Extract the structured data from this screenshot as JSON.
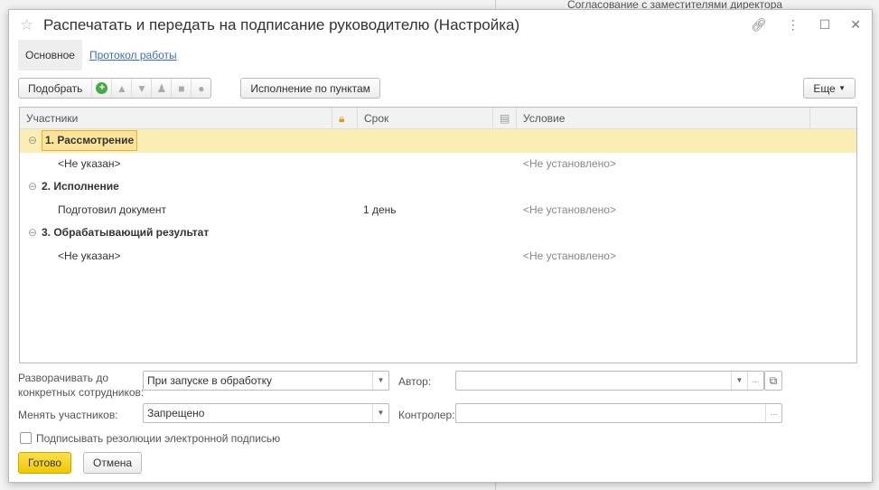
{
  "background": {
    "text": "Согласование с заместителями директора"
  },
  "window": {
    "title": "Распечатать и передать на подписание руководителю (Настройка)"
  },
  "tabs": [
    {
      "label": "Основное",
      "active": true
    },
    {
      "label": "Протокол работы",
      "active": false
    }
  ],
  "toolbar": {
    "pick": "Подобрать",
    "execution_by_items": "Исполнение по пунктам",
    "more": "Еще"
  },
  "table": {
    "columns": [
      "Участники",
      "Срок",
      "Условие"
    ],
    "rows": [
      {
        "type": "group",
        "participant": "1. Рассмотрение",
        "term": "",
        "condition": "",
        "selected": true
      },
      {
        "type": "item",
        "participant": "<Не указан>",
        "term": "",
        "condition": "<Не установлено>"
      },
      {
        "type": "group",
        "participant": "2. Исполнение",
        "term": "",
        "condition": ""
      },
      {
        "type": "item",
        "participant": "Подготовил документ",
        "term": "1 день",
        "condition": "<Не установлено>"
      },
      {
        "type": "group",
        "participant": "3. Обрабатывающий результат",
        "term": "",
        "condition": ""
      },
      {
        "type": "item",
        "participant": "<Не указан>",
        "term": "",
        "condition": "<Не установлено>"
      }
    ]
  },
  "form": {
    "expand_label_1": "Разворачивать до",
    "expand_label_2": "конкретных сотрудников:",
    "expand_value": "При запуске в обработку",
    "author_label": "Автор:",
    "author_value": "",
    "change_label": "Менять участников:",
    "change_value": "Запрещено",
    "controller_label": "Контролер:",
    "controller_value": "",
    "sign_label": "Подписывать резолюции электронной подписью",
    "sign_checked": false
  },
  "buttons": {
    "ok": "Готово",
    "cancel": "Отмена"
  },
  "colors": {
    "accent": "#f5d130",
    "selected_row": "#fbeeb5",
    "link": "#3c6eb4"
  }
}
